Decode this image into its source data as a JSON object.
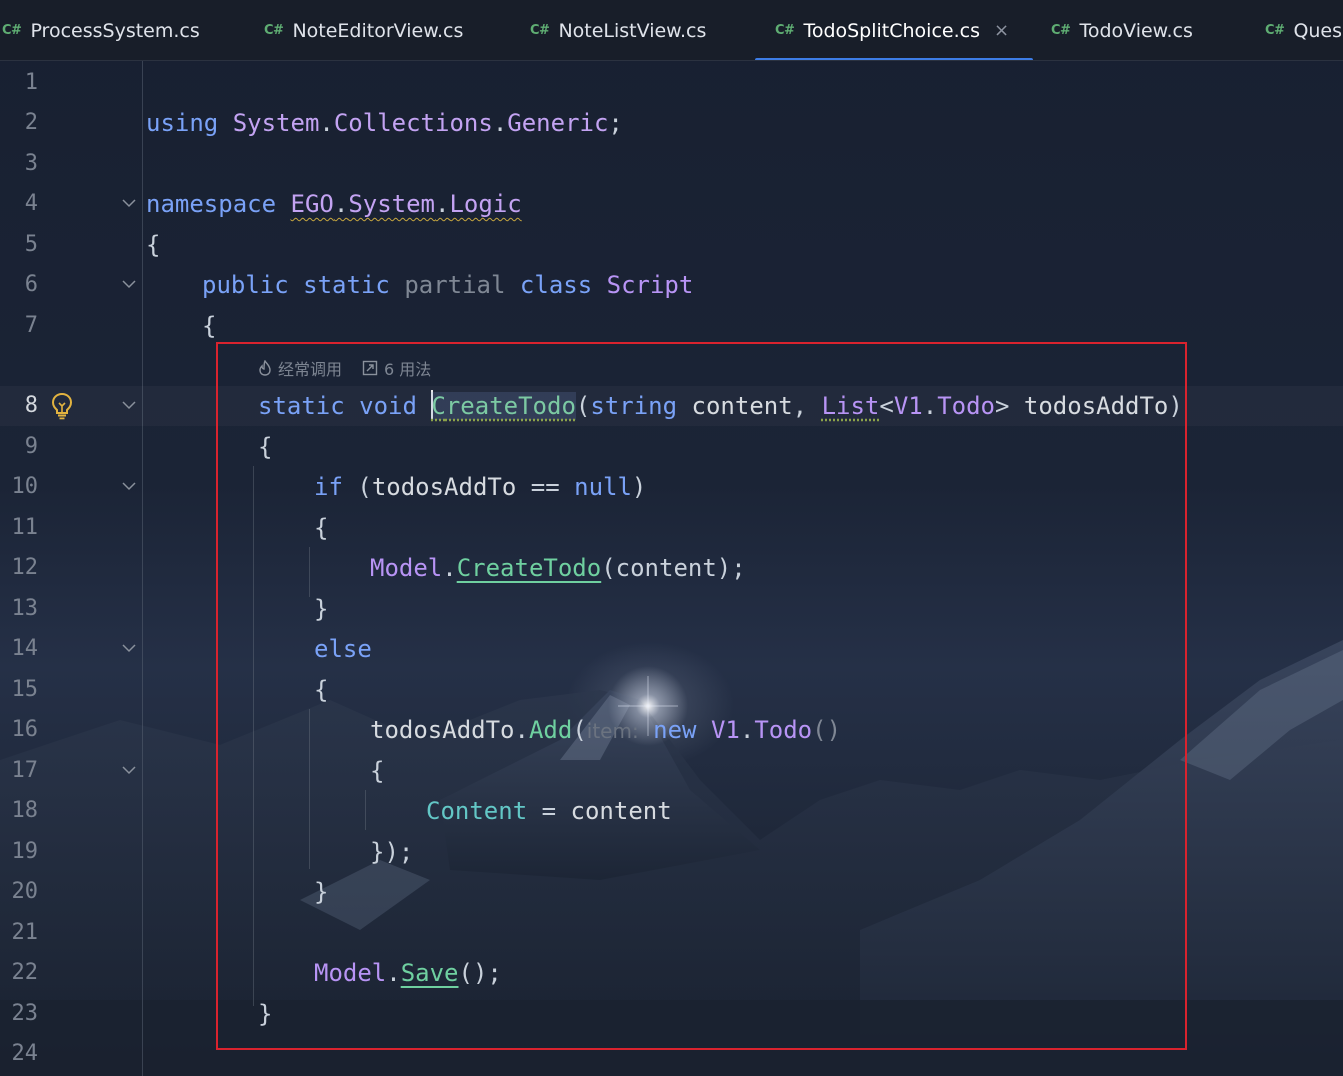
{
  "tabs": [
    {
      "lang": "C#",
      "name": "ProcessSystem.cs",
      "active": false
    },
    {
      "lang": "C#",
      "name": "NoteEditorView.cs",
      "active": false
    },
    {
      "lang": "C#",
      "name": "NoteListView.cs",
      "active": false
    },
    {
      "lang": "C#",
      "name": "TodoSplitChoice.cs",
      "active": true,
      "close": "×"
    },
    {
      "lang": "C#",
      "name": "TodoView.cs",
      "active": false
    },
    {
      "lang": "C#",
      "name": "Ques",
      "active": false
    }
  ],
  "code_lens": {
    "frequent": "经常调用",
    "usages": "6 用法"
  },
  "line_numbers": [
    "1",
    "2",
    "3",
    "4",
    "5",
    "6",
    "7",
    "8",
    "9",
    "10",
    "11",
    "12",
    "13",
    "14",
    "15",
    "16",
    "17",
    "18",
    "19",
    "20",
    "21",
    "22",
    "23",
    "24"
  ],
  "code": {
    "l2": {
      "using": "using",
      "ns1": "System",
      "ns2": "Collections",
      "ns3": "Generic",
      "end": ";"
    },
    "l4": {
      "kw": "namespace",
      "ns1": "EGO",
      "ns2": "System",
      "ns3": "Logic"
    },
    "brace_open": "{",
    "brace_close": "}",
    "l6": {
      "public": "public",
      "static": "static",
      "partial": "partial",
      "class": "class",
      "name": "Script"
    },
    "l8": {
      "static": "static",
      "void": "void",
      "method_first": "C",
      "method_rest": "reateTodo",
      "open": "(",
      "string": "string",
      "p1": "content",
      "comma": ",",
      "list": "List",
      "lt": "<",
      "v1": "V1",
      "todo": "Todo",
      "gt": ">",
      "p2": "todosAddTo",
      "close": ")"
    },
    "l10": {
      "if": "if",
      "open": "(",
      "var": "todosAddTo",
      "op": "==",
      "null": "null",
      "close": ")"
    },
    "l12": {
      "model": "Model",
      "method": "CreateTodo",
      "args": "(content);"
    },
    "l14": {
      "else": "else"
    },
    "l16": {
      "var": "todosAddTo",
      "add": "Add",
      "open": "(",
      "hint": "item:",
      "new": "new",
      "v1": "V1",
      "todo": "Todo",
      "parens": "()"
    },
    "l18": {
      "prop": "Content",
      "eq": "=",
      "val": "content"
    },
    "l19": {
      "end": "});"
    },
    "l22": {
      "model": "Model",
      "save": "Save",
      "end": "();"
    }
  }
}
